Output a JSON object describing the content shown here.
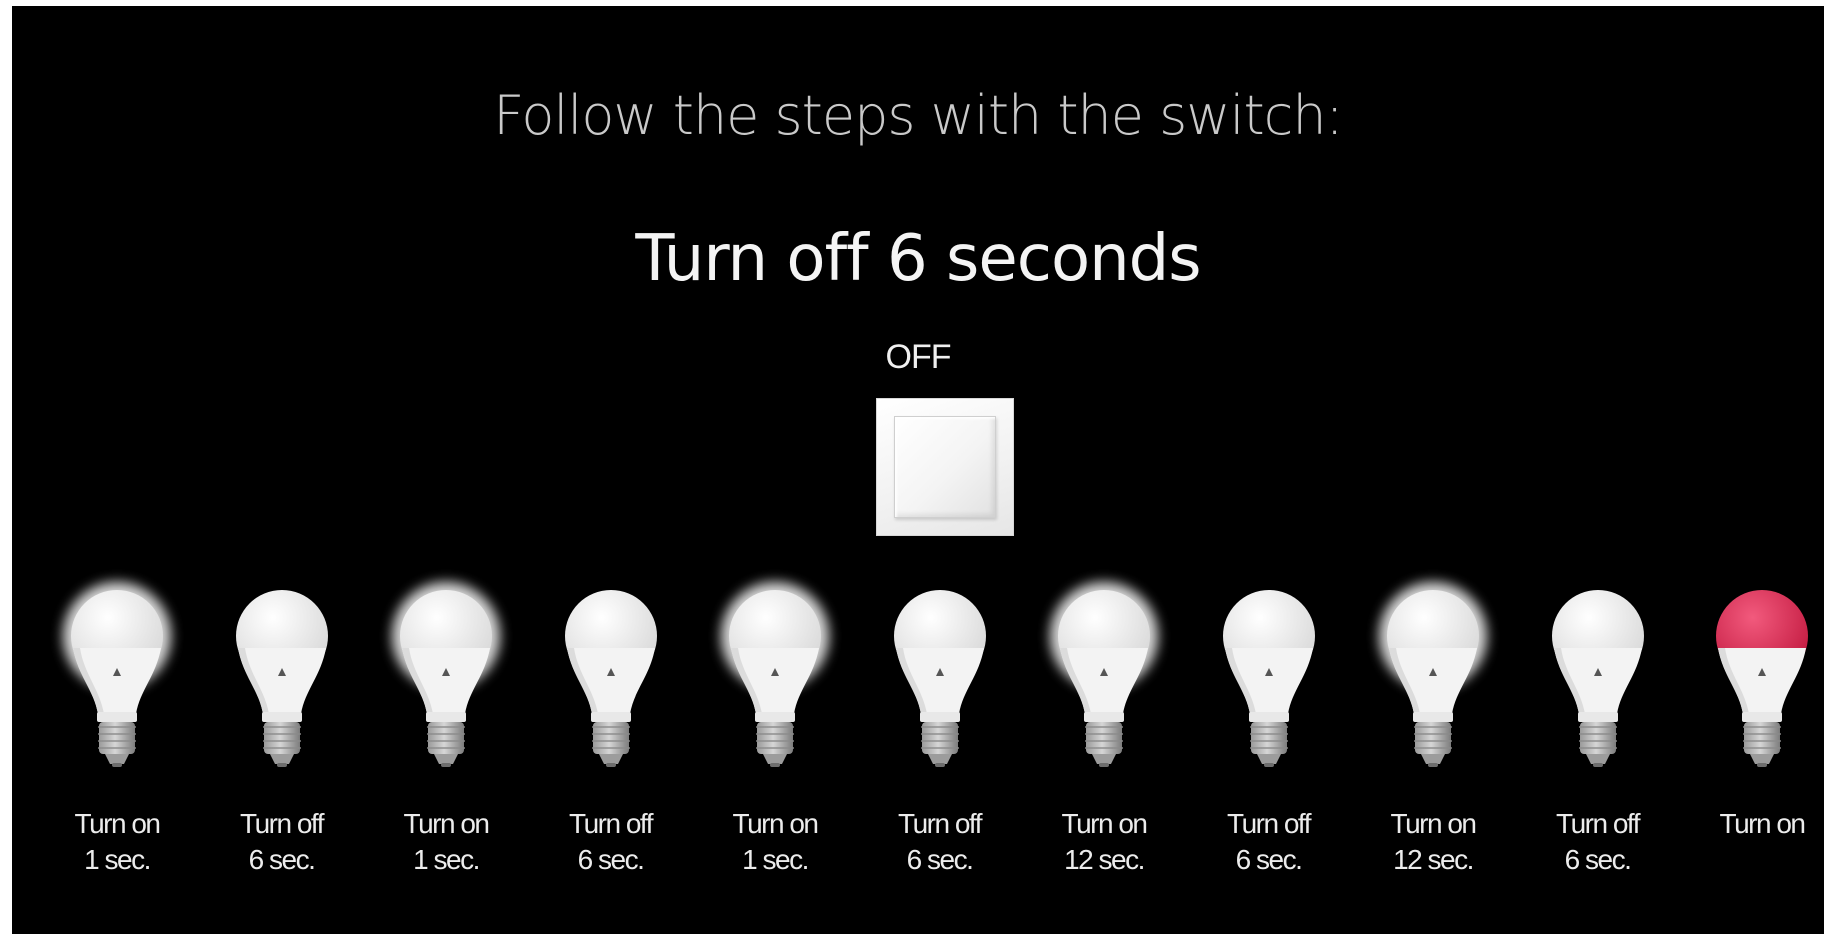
{
  "instruction": "Follow the steps with the switch:",
  "current_step": "Turn off 6 seconds",
  "switch": {
    "state_label": "OFF"
  },
  "colors": {
    "background": "#000000",
    "bulb_white": "#f2f2f2",
    "bulb_red": "#e0284e",
    "glow": "#ffffff"
  },
  "steps": [
    {
      "line1": "Turn on",
      "line2": "1 sec.",
      "lit": true,
      "color": "white"
    },
    {
      "line1": "Turn off",
      "line2": "6 sec.",
      "lit": false,
      "color": "white"
    },
    {
      "line1": "Turn on",
      "line2": "1 sec.",
      "lit": true,
      "color": "white"
    },
    {
      "line1": "Turn off",
      "line2": "6 sec.",
      "lit": false,
      "color": "white"
    },
    {
      "line1": "Turn on",
      "line2": "1 sec.",
      "lit": true,
      "color": "white"
    },
    {
      "line1": "Turn off",
      "line2": "6 sec.",
      "lit": false,
      "color": "white"
    },
    {
      "line1": "Turn on",
      "line2": "12 sec.",
      "lit": true,
      "color": "white"
    },
    {
      "line1": "Turn off",
      "line2": "6 sec.",
      "lit": false,
      "color": "white"
    },
    {
      "line1": "Turn on",
      "line2": "12 sec.",
      "lit": true,
      "color": "white"
    },
    {
      "line1": "Turn off",
      "line2": "6 sec.",
      "lit": false,
      "color": "white"
    },
    {
      "line1": "Turn on",
      "line2": "",
      "lit": true,
      "color": "red"
    }
  ]
}
